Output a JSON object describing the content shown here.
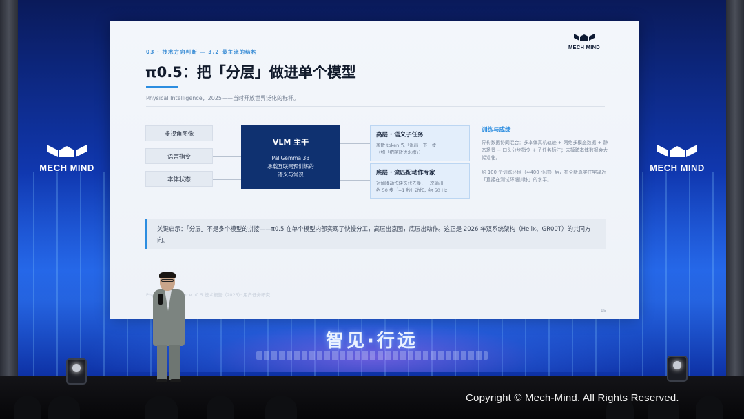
{
  "slide": {
    "section": "03 · 技术方向判断 — 3.2 最主流的结构",
    "title": "π0.5：把「分层」做进单个模型",
    "subtitle": "Physical Intelligence，2025——当时开放世界泛化的标杆。",
    "logo_text": "MECH MIND",
    "inputs": [
      "多视角图像",
      "语言指令",
      "本体状态"
    ],
    "vlm": {
      "heading": "VLM 主干",
      "lines": [
        "PaliGemma 3B",
        "承载互联网预训练的",
        "语义与常识"
      ]
    },
    "tiers": [
      {
        "heading": "高层 · 语义子任务",
        "lines": [
          "离散 token 先「说出」下一步",
          "（如「把碗放进水槽」）"
        ]
      },
      {
        "heading": "底层 · 流匹配动作专家",
        "lines": [
          "对加噪动作块迭代去噪，一次输出",
          "约 50 步（≈1 秒）动作，约 50 Hz"
        ]
      }
    ],
    "training": {
      "heading": "训练与成绩",
      "paragraphs": [
        "异构数据协同混合：多本体真机轨迹 + 网络多模态数据 + 静态场景 + 口头分步指令 + 子任务标注；去掉跨本体数据会大幅退化。",
        "约 100 个训练环境（≈400 小时）后，在全新真实住宅逼近「直接在测试环境训练」的水平。"
      ]
    },
    "insight": "关键启示：「分层」不是多个模型的拼接——π0.5 在单个模型内部实现了快慢分工，高层出意图，底层出动作。这正是 2026 年双系统架构（Helix、GR00T）的共同方向。",
    "page_number": "15"
  },
  "stage": {
    "brand_text": "MECH MIND",
    "slogan": "智见·行远"
  },
  "watermark": "Copyright © Mech-Mind. All Rights Reserved."
}
